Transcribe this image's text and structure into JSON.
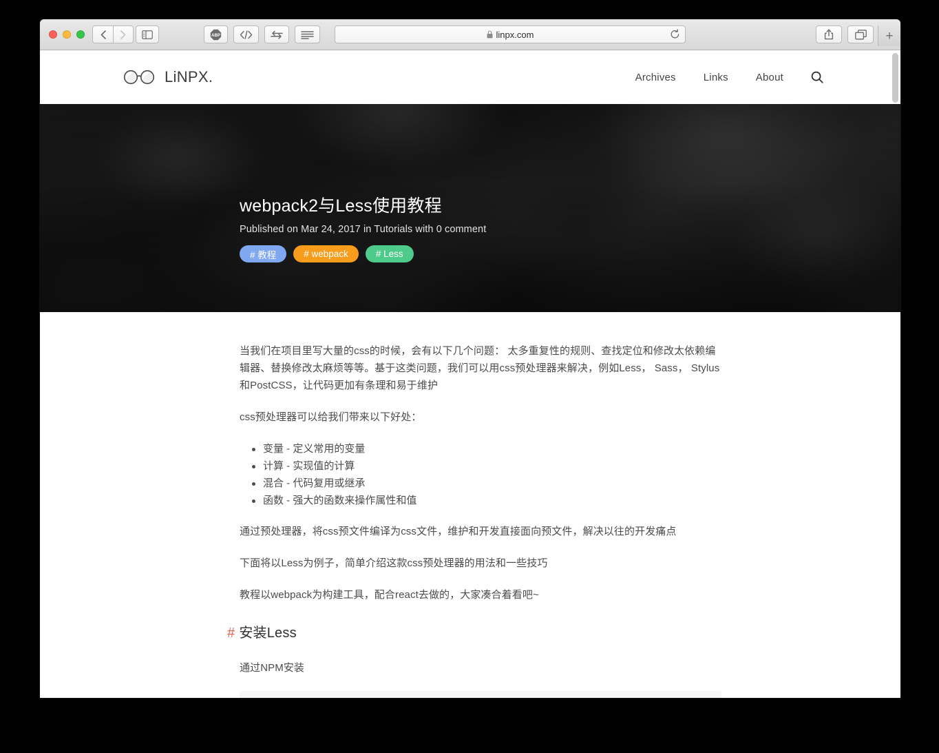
{
  "browser": {
    "traffic_lights": [
      "close",
      "minimize",
      "maximize"
    ],
    "back_label": "‹",
    "forward_label": "›",
    "sidebar_icon": "sidebar-icon",
    "extensions": [
      {
        "name": "adblock-plus",
        "label": "ABP"
      },
      {
        "name": "code-view",
        "label": "</>"
      },
      {
        "name": "swap-arrows",
        "label": "⇄"
      }
    ],
    "reader_icon": "reader-lines-icon",
    "url": "linpx.com",
    "url_secure": true,
    "reload_label": "↻",
    "share_icon": "share-icon",
    "tabs_icon": "tab-overview-icon",
    "new_tab_label": "+"
  },
  "site": {
    "brand": "LiNPX.",
    "logo_icon": "glasses-logo-icon",
    "nav": [
      {
        "label": "Archives"
      },
      {
        "label": "Links"
      },
      {
        "label": "About"
      }
    ],
    "search_icon": "search-icon"
  },
  "post": {
    "title": "webpack2与Less使用教程",
    "meta": "Published on Mar 24, 2017 in Tutorials with 0 comment",
    "tags": [
      {
        "label": "# 教程",
        "color": "#7FA8F0"
      },
      {
        "label": "# webpack",
        "color": "#F89C1C"
      },
      {
        "label": "# Less",
        "color": "#4ECB8A"
      }
    ]
  },
  "article": {
    "paragraphs": [
      "当我们在项目里写大量的css的时候，会有以下几个问题： 太多重复性的规则、查找定位和修改太依赖编辑器、替换修改太麻烦等等。基于这类问题，我们可以用css预处理器来解决，例如Less， Sass， Stylus和PostCSS，让代码更加有条理和易于维护",
      "css预处理器可以给我们带来以下好处："
    ],
    "benefits": [
      "变量 - 定义常用的变量",
      "计算 - 实现值的计算",
      "混合 - 代码复用或继承",
      "函数 - 强大的函数来操作属性和值"
    ],
    "paragraphs_after": [
      "通过预处理器，将css预文件编译为css文件，维护和开发直接面向预文件，解决以往的开发痛点",
      "下面将以Less为例子，简单介绍这款css预处理器的用法和一些技巧",
      "教程以webpack为构建工具，配合react去做的，大家凑合着看吧~"
    ],
    "section": {
      "hash": "#",
      "heading": "安装Less",
      "intro": "通过NPM安装"
    }
  }
}
